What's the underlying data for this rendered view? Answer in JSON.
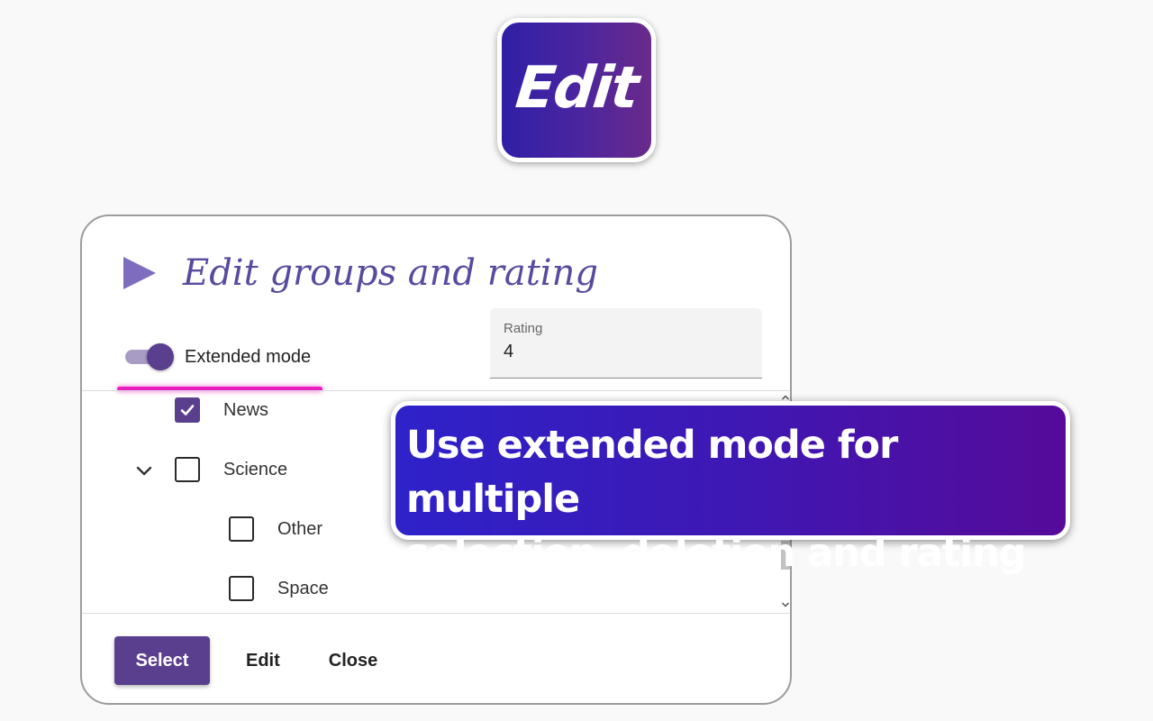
{
  "logo": {
    "text": "Edit"
  },
  "dialog": {
    "title": "Edit groups and rating",
    "extended_mode": {
      "label": "Extended mode",
      "on": true
    },
    "rating": {
      "label": "Rating",
      "value": "4"
    },
    "groups": [
      {
        "label": "News",
        "checked": true,
        "level": 0
      },
      {
        "label": "Science",
        "checked": false,
        "level": 0,
        "expanded": true
      },
      {
        "label": "Other",
        "checked": false,
        "level": 1
      },
      {
        "label": "Space",
        "checked": false,
        "level": 1
      }
    ],
    "buttons": {
      "select": "Select",
      "edit": "Edit",
      "close": "Close"
    }
  },
  "callout": {
    "line1": "Use extended mode for multiple",
    "line2": "selection, deletion and rating"
  },
  "colors": {
    "accent": "#5a3f8e",
    "title": "#5a4a9e",
    "highlight": "#e81fbe",
    "callout_start": "#2e22c9",
    "callout_end": "#560a9a"
  }
}
